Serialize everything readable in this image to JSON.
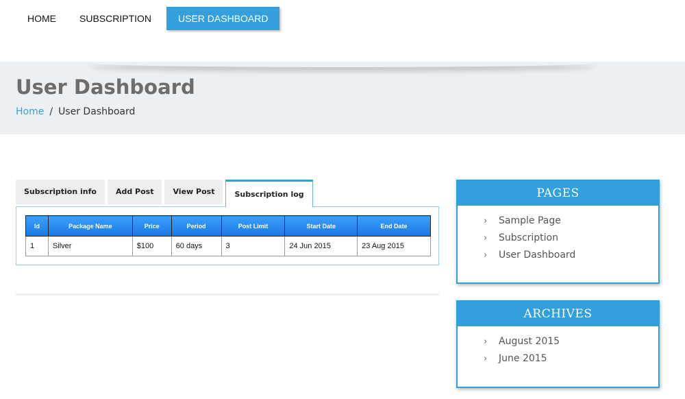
{
  "nav": {
    "items": [
      {
        "label": "HOME"
      },
      {
        "label": "SUBSCRIPTION"
      },
      {
        "label": "USER DASHBOARD"
      }
    ]
  },
  "banner": {
    "title": "User Dashboard",
    "breadcrumb": {
      "home": "Home",
      "separator": "/",
      "current": "User Dashboard"
    }
  },
  "tabs": [
    {
      "label": "Subscription info"
    },
    {
      "label": "Add Post"
    },
    {
      "label": "View Post"
    },
    {
      "label": "Subscription log"
    }
  ],
  "table": {
    "headers": [
      "Id",
      "Package Name",
      "Price",
      "Period",
      "Post Limit",
      "Start Date",
      "End Date"
    ],
    "rows": [
      [
        "1",
        "Silver",
        "$100",
        "60 days",
        "3",
        "24 Jun 2015",
        "23 Aug 2015"
      ]
    ]
  },
  "sidebar": {
    "pages": {
      "title": "PAGES",
      "items": [
        "Sample Page",
        "Subscription",
        "User Dashboard"
      ]
    },
    "archives": {
      "title": "ARCHIVES",
      "items": [
        "August 2015",
        "June 2015"
      ]
    }
  },
  "colors": {
    "accent": "#33a0dd",
    "banner_bg": "#edf0f2",
    "table_header": "#1a78e0"
  },
  "icons": {
    "list_bullet": "chevron-right-icon"
  }
}
